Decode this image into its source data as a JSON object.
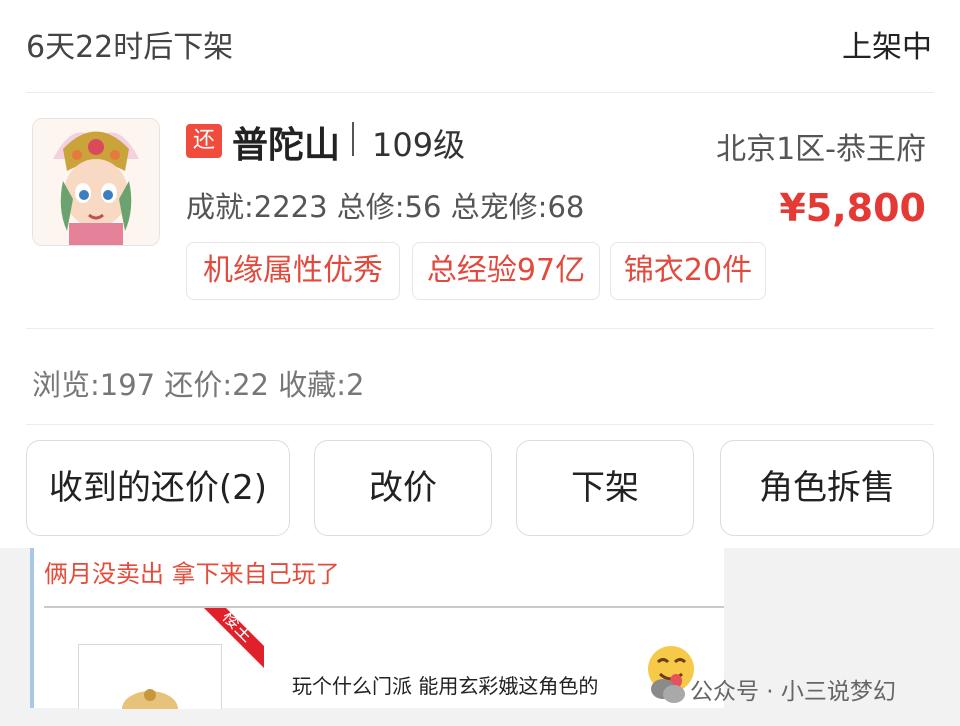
{
  "header": {
    "expire_text": "6天22时后下架",
    "status_text": "上架中"
  },
  "role": {
    "return_badge": "还",
    "school": "普陀山",
    "level": "109级",
    "server": "北京1区-恭王府",
    "stats": "成就:2223 总修:56 总宠修:68",
    "price": "¥5,800",
    "tags": [
      "机缘属性优秀",
      "总经验97亿",
      "锦衣20件"
    ]
  },
  "counts": "浏览:197 还价:22 收藏:2",
  "actions": {
    "offers": "收到的还价(2)",
    "change_price": "改价",
    "delist": "下架",
    "split_sale": "角色拆售"
  },
  "overlay": {
    "title": "俩月没卖出 拿下来自己玩了",
    "badge": "楼主",
    "text": "玩个什么门派 能用玄彩娥这角色的"
  },
  "watermark": "公众号 · 小三说梦幻",
  "colors": {
    "accent_red": "#e53935",
    "tag_red": "#e14a3c",
    "badge_red": "#f04b3c"
  }
}
